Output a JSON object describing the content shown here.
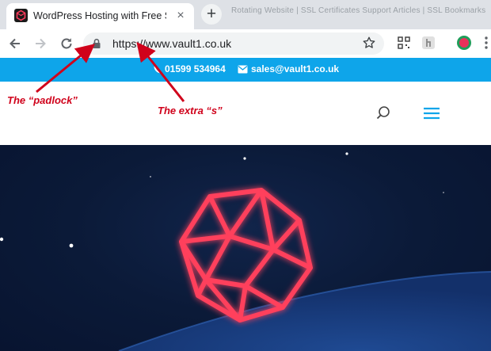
{
  "browser": {
    "tab": {
      "title": "WordPress Hosting with Free SSL",
      "close_glyph": "×"
    },
    "new_tab_glyph": "+",
    "background_tab_text": "Rotating Website | SSL Certificates Support Articles | SSL Bookmarks"
  },
  "address_bar": {
    "url": "https://www.vault1.co.uk"
  },
  "site": {
    "topbar": {
      "phone": "01599 534964",
      "email": "sales@vault1.co.uk",
      "background_color": "#0ea5ea"
    }
  },
  "annotations": {
    "padlock_label": "The “padlock”",
    "extra_s_label": "The extra “s”",
    "color": "#d0021b"
  },
  "icons": [
    "favicon-icon",
    "close-icon",
    "back-icon",
    "forward-icon",
    "reload-icon",
    "padlock-icon",
    "star-icon",
    "qr-icon",
    "extension-icon",
    "profile-icon",
    "menu-icon",
    "phone-icon",
    "mail-icon",
    "search-icon",
    "hamburger-icon",
    "logo-icon"
  ]
}
